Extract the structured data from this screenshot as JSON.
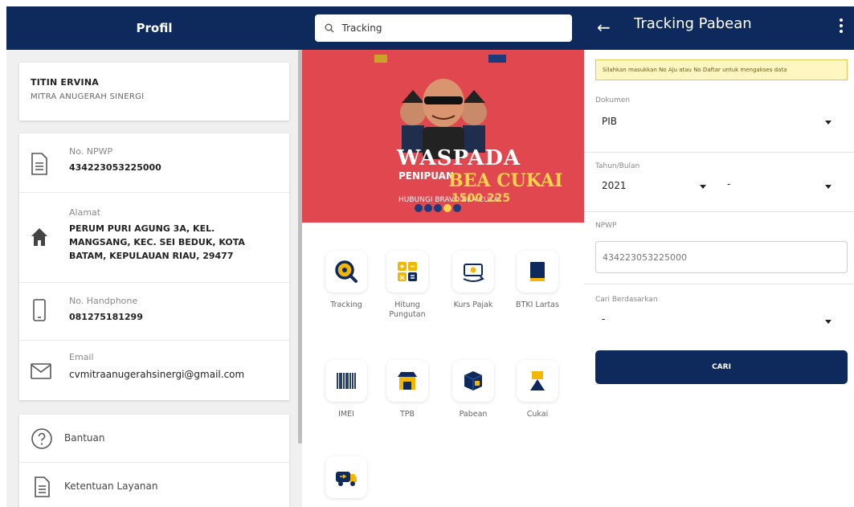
{
  "profile": {
    "title": "Profil",
    "name": "TITIN ERVINA",
    "company": "MITRA ANUGERAH SINERGI",
    "npwp_label": "No. NPWP",
    "npwp_value": "434223053225000",
    "address_label": "Alamat",
    "address_value": "PERUM PURI AGUNG 3A, KEL. MANGSANG, KEC. SEI BEDUK, KOTA BATAM, KEPULAUAN RIAU, 29477",
    "phone_label": "No. Handphone",
    "phone_value": "081275181299",
    "email_label": "Email",
    "email_value": "cvmitraanugerahsinergi@gmail.com",
    "help_label": "Bantuan",
    "terms_label": "Ketentuan Layanan"
  },
  "home": {
    "search_text": "Tracking",
    "banner": {
      "line1": "WASPADA",
      "line2": "PENIPUAN",
      "line3": "BEA CUKAI",
      "line4": "HUBUNGI BRAVO BEA CUKAI",
      "line5": "1500 225"
    },
    "menu": [
      {
        "label": "Tracking",
        "icon": "magnifier-icon"
      },
      {
        "label": "Hitung Pungutan",
        "icon": "calculator-icon"
      },
      {
        "label": "Kurs Pajak",
        "icon": "currency-exchange-icon"
      },
      {
        "label": "BTKI Lartas",
        "icon": "book-icon"
      },
      {
        "label": "IMEI",
        "icon": "barcode-icon"
      },
      {
        "label": "TPB",
        "icon": "warehouse-icon"
      },
      {
        "label": "Pabean",
        "icon": "package-icon"
      },
      {
        "label": "Cukai",
        "icon": "excise-icon"
      },
      {
        "label": "",
        "icon": "delivery-truck-icon"
      }
    ]
  },
  "tracking": {
    "title": "Tracking Pabean",
    "notice": "Silahkan masukkan No Aju atau No Daftar untuk mengakses data",
    "dokumen_label": "Dokumen",
    "dokumen_value": "PIB",
    "tahun_label": "Tahun/Bulan",
    "tahun_value": "2021",
    "bulan_value": "-",
    "npwp_label": "NPWP",
    "npwp_value": "434223053225000",
    "cari_label": "Cari Berdasarkan",
    "cari_value": "-",
    "button_label": "CARI"
  },
  "colors": {
    "navy": "#0e2a5c",
    "banner_red": "#e0474f",
    "accent_yellow": "#ffd34d"
  }
}
